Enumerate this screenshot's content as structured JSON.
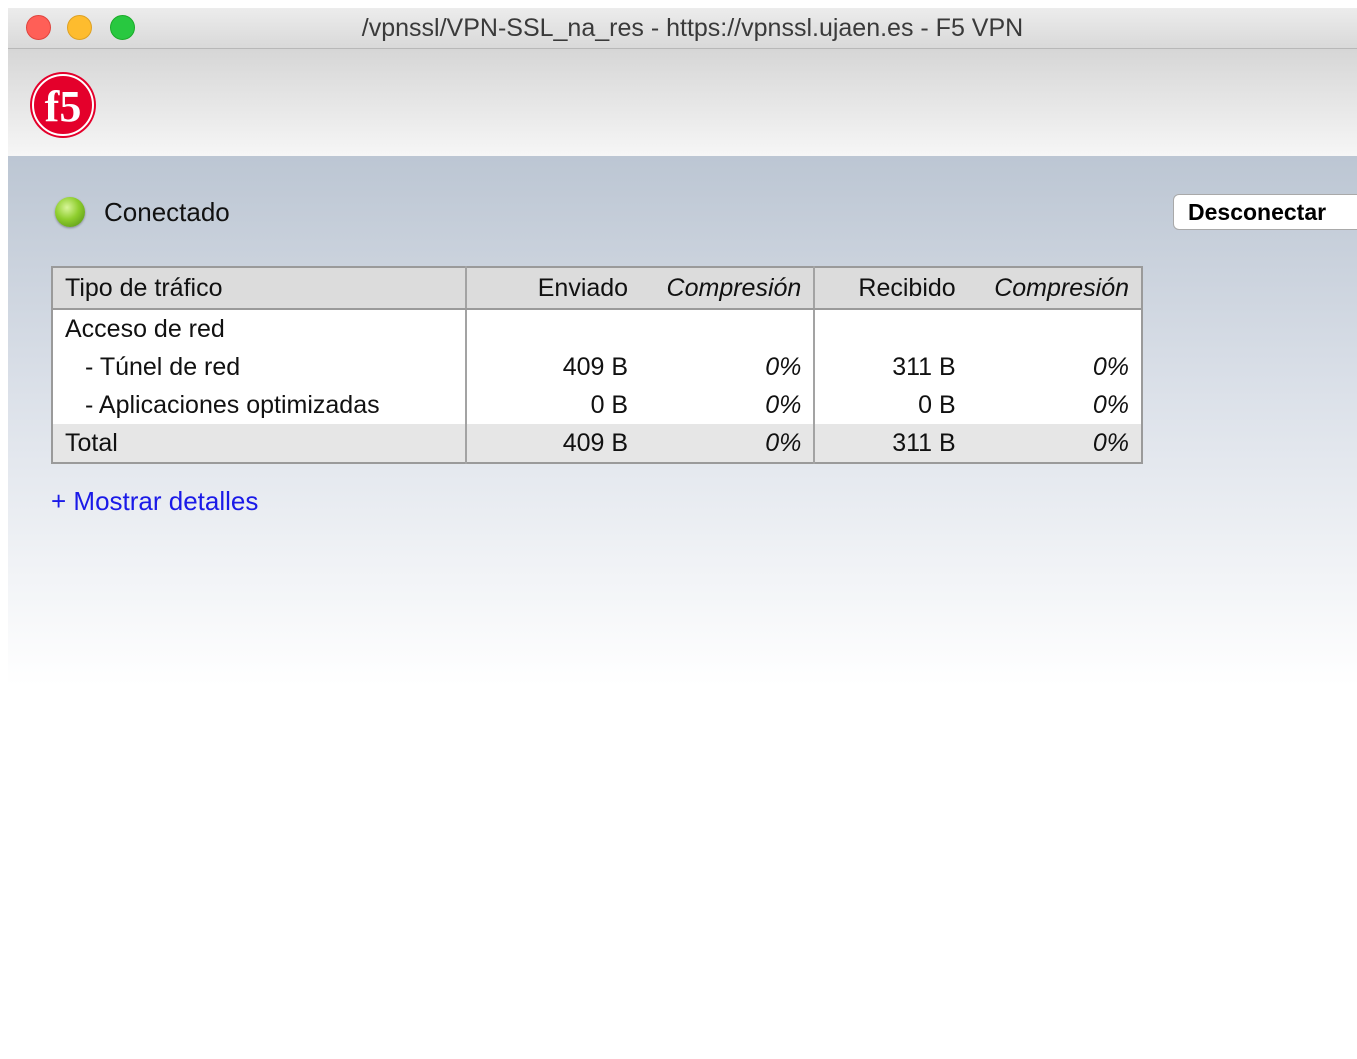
{
  "window": {
    "title": "/vpnssl/VPN-SSL_na_res - https://vpnssl.ujaen.es - F5 VPN"
  },
  "header": {
    "logo_text": "f5"
  },
  "status": {
    "label": "Conectado",
    "indicator_color": "#8fce2e"
  },
  "actions": {
    "disconnect_label": "Desconectar",
    "show_details_label": "+ Mostrar detalles"
  },
  "table": {
    "headers": {
      "type": "Tipo de tráfico",
      "sent": "Enviado",
      "sent_compression": "Compresión",
      "received": "Recibido",
      "received_compression": "Compresión"
    },
    "rows": [
      {
        "type": "Acceso de red",
        "sent": "",
        "sent_compression": "",
        "received": "",
        "received_compression": ""
      },
      {
        "type": "- Túnel de red",
        "sent": "409 B",
        "sent_compression": "0%",
        "received": "311 B",
        "received_compression": "0%"
      },
      {
        "type": "- Aplicaciones optimizadas",
        "sent": "0 B",
        "sent_compression": "0%",
        "received": "0 B",
        "received_compression": "0%"
      }
    ],
    "total": {
      "type": "Total",
      "sent": "409 B",
      "sent_compression": "0%",
      "received": "311 B",
      "received_compression": "0%"
    }
  },
  "colors": {
    "link": "#1a1ae8",
    "brand_red": "#e4002b"
  }
}
